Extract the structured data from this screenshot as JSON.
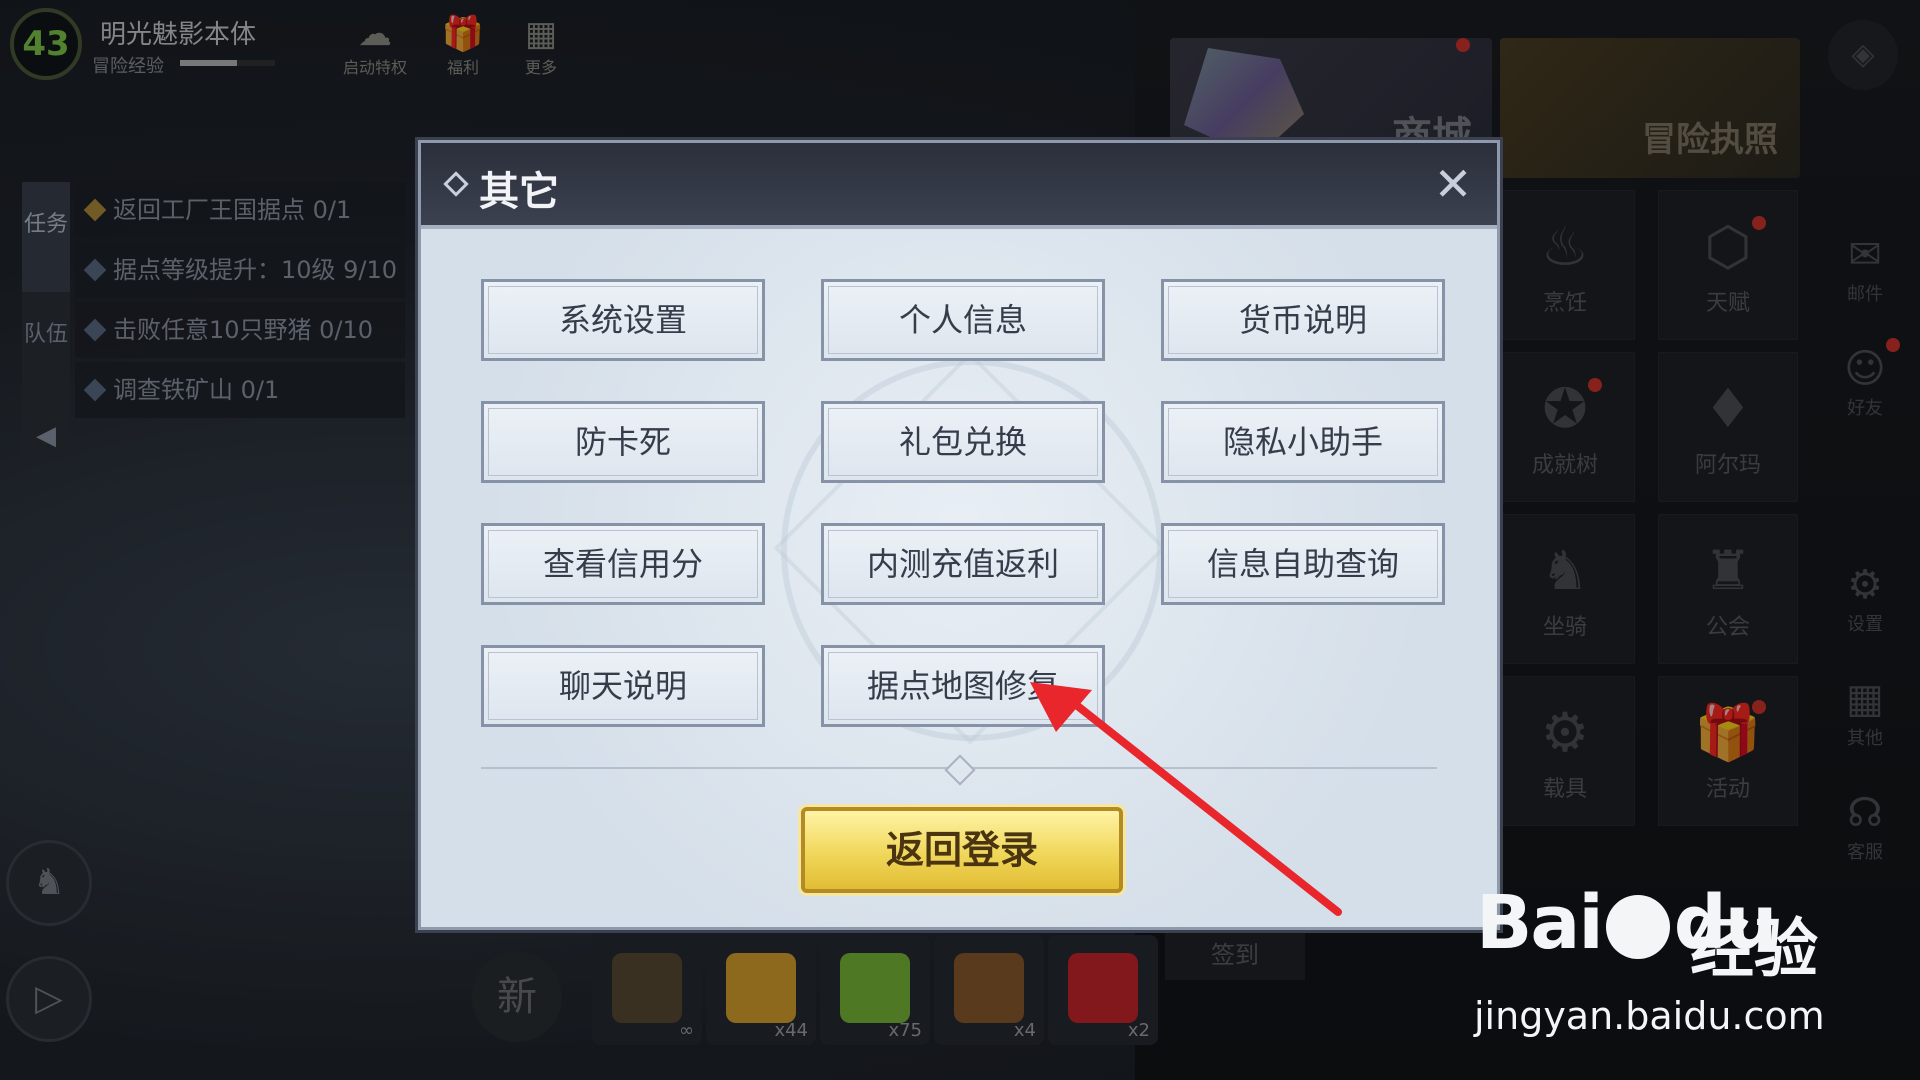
{
  "hud": {
    "level": "43",
    "player_name": "明光魅影本体",
    "exp_label": "冒险经验",
    "exp_fraction": 0.6,
    "top_buttons": [
      {
        "label": "启动特权",
        "icon": "wechat-icon"
      },
      {
        "label": "福利",
        "icon": "gift-icon"
      },
      {
        "label": "更多",
        "icon": "more-icon"
      }
    ]
  },
  "quests": {
    "tabs": [
      "任务",
      "队伍"
    ],
    "items": [
      "返回工厂王国据点 0/1",
      "据点等级提升：10级 9/10",
      "击败任意10只野猪 0/10",
      "调查铁矿山 0/1"
    ]
  },
  "right_menu": {
    "shop_label": "商城",
    "license_label": "冒险执照",
    "tiles": [
      "烹饪",
      "天赋",
      "成就树",
      "阿尔玛",
      "坐骑",
      "公会",
      "载具",
      "活动"
    ],
    "side": [
      "邮件",
      "好友",
      "设置",
      "其他",
      "客服"
    ],
    "checkin": "签到"
  },
  "hotbar": {
    "new_label": "新",
    "slots": [
      {
        "count": "∞",
        "color": "#5a4a33"
      },
      {
        "count": "x44",
        "color": "#d9a12e"
      },
      {
        "count": "x75",
        "color": "#7ab83a"
      },
      {
        "count": "x4",
        "color": "#8b5a2b"
      },
      {
        "count": "x2",
        "color": "#c8242b"
      }
    ]
  },
  "dialog": {
    "title": "其它",
    "buttons": [
      "系统设置",
      "个人信息",
      "货币说明",
      "防卡死",
      "礼包兑换",
      "隐私小助手",
      "查看信用分",
      "内测充值返利",
      "信息自助查询",
      "聊天说明",
      "据点地图修复"
    ],
    "return_label": "返回登录"
  },
  "watermark": {
    "brand": "Bai",
    "brand2": "du",
    "exp": "经验",
    "url": "jingyan.baidu.com"
  },
  "colors": {
    "accent_gold": "#f0d75a",
    "arrow_red": "#e8262b",
    "dialog_bg": "#dfe6ee"
  }
}
